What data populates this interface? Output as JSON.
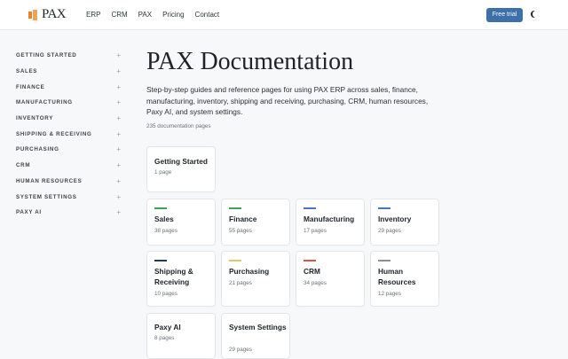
{
  "header": {
    "logo_text": "PAX",
    "nav": [
      "ERP",
      "CRM",
      "PAX",
      "Pricing",
      "Contact"
    ],
    "cta_label": "Free trial",
    "theme_icon": "moon-icon",
    "accent_color": "#3d6fa8",
    "logo_color": "#e8822d"
  },
  "sidebar": {
    "items": [
      {
        "label": "GETTING STARTED",
        "toggle": "+"
      },
      {
        "label": "SALES",
        "toggle": "+"
      },
      {
        "label": "FINANCE",
        "toggle": "+"
      },
      {
        "label": "MANUFACTURING",
        "toggle": "+"
      },
      {
        "label": "INVENTORY",
        "toggle": "+"
      },
      {
        "label": "SHIPPING & RECEIVING",
        "toggle": "+"
      },
      {
        "label": "PURCHASING",
        "toggle": "+"
      },
      {
        "label": "CRM",
        "toggle": "+"
      },
      {
        "label": "HUMAN RESOURCES",
        "toggle": "+"
      },
      {
        "label": "SYSTEM SETTINGS",
        "toggle": "+"
      },
      {
        "label": "PAXY AI",
        "toggle": "+"
      }
    ]
  },
  "main": {
    "title": "PAX Documentation",
    "description": "Step-by-step guides and reference pages for using PAX ERP across sales, finance, manufacturing, inventory, shipping and receiving, purchasing, CRM, human resources, Paxy AI, and system settings.",
    "count": "235 documentation pages",
    "cards": [
      {
        "title": "Getting Started",
        "pages": "1 page",
        "color": ""
      },
      {
        "title": "Sales",
        "pages": "38 pages",
        "color": "#3aa655"
      },
      {
        "title": "Finance",
        "pages": "55 pages",
        "color": "#3aa655"
      },
      {
        "title": "Manufacturing",
        "pages": "17 pages",
        "color": "#4a78b5"
      },
      {
        "title": "Inventory",
        "pages": "29 pages",
        "color": "#4a78b5"
      },
      {
        "title": "Shipping & Receiving",
        "pages": "10 pages",
        "color": "#1f3a63"
      },
      {
        "title": "Purchasing",
        "pages": "21 pages",
        "color": "#e9c46a"
      },
      {
        "title": "CRM",
        "pages": "34 pages",
        "color": "#d9534f"
      },
      {
        "title": "Human Resources",
        "pages": "12 pages",
        "color": "#8a8f96"
      },
      {
        "title": "Paxy AI",
        "pages": "8 pages",
        "color": ""
      },
      {
        "title": "System Settings",
        "pages": "29 pages",
        "color": ""
      }
    ]
  }
}
